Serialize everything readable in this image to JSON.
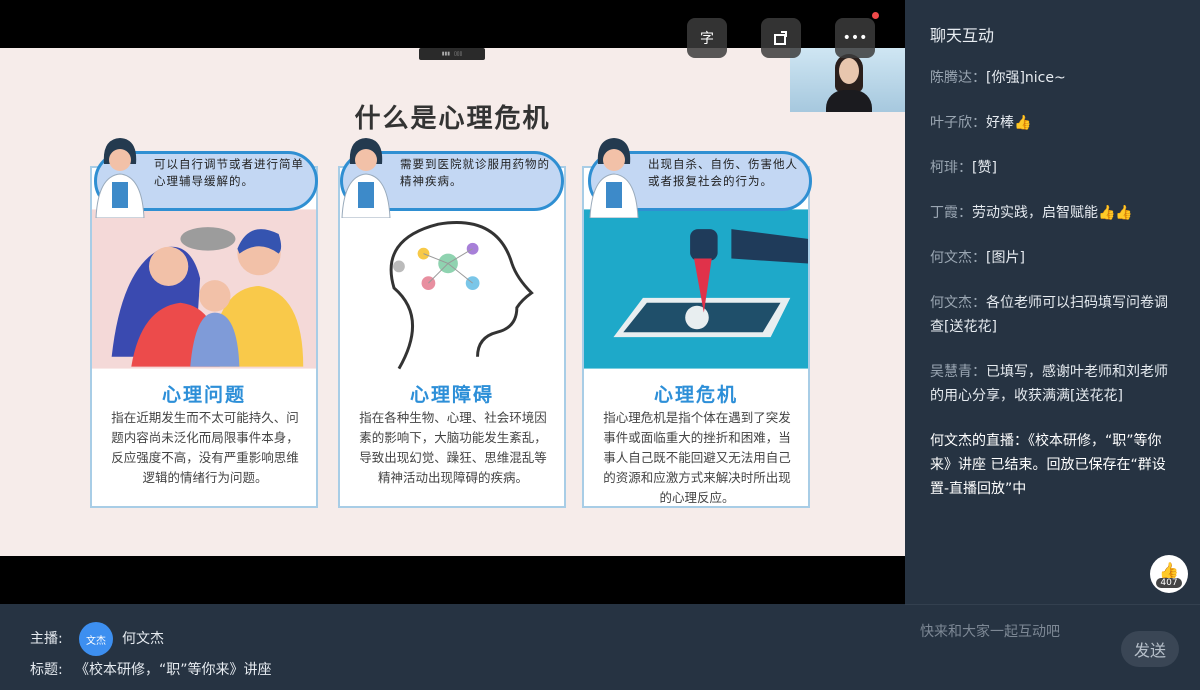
{
  "slide": {
    "title": "什么是心理危机",
    "cards": [
      {
        "bubble": "可以自行调节或者进行简单心理辅导缓解的。",
        "name": "心理问题",
        "desc": "指在近期发生而不太可能持久、问题内容尚未泛化而局限事件本身，反应强度不高，没有严重影响思维逻辑的情绪行为问题。"
      },
      {
        "bubble": "需要到医院就诊服用药物的精神疾病。",
        "name": "心理障碍",
        "desc": "指在各种生物、心理、社会环境因素的影响下，大脑功能发生紊乱，导致出现幻觉、躁狂、思维混乱等精神活动出现障碍的疾病。"
      },
      {
        "bubble": "出现自杀、自伤、伤害他人或者报复社会的行为。",
        "name": "心理危机",
        "desc": "指心理危机是指个体在遇到了突发事件或面临重大的挫折和困难，当事人自己既不能回避又无法用自己的资源和应激方式来解决时所出现的心理反应。"
      }
    ]
  },
  "controls": {
    "subtitle_icon": "字",
    "rotate_icon": "rotate-icon",
    "more_icon": "•••"
  },
  "chat": {
    "title": "聊天互动",
    "messages": [
      {
        "who": "陈腾达：",
        "text": "[你强]nice~"
      },
      {
        "who": "叶子欣：",
        "text": "好棒👍"
      },
      {
        "who": "柯琲：",
        "text": "[赞]"
      },
      {
        "who": "丁霞：",
        "text": "劳动实践，启智赋能👍👍"
      },
      {
        "who": "何文杰：",
        "text": "[图片]"
      },
      {
        "who": "何文杰：",
        "text": "各位老师可以扫码填写问卷调查[送花花]"
      },
      {
        "who": "吴慧青：",
        "text": "已填写，感谢叶老师和刘老师的用心分享，收获满满[送花花]"
      }
    ],
    "system": "何文杰的直播：《校本研修，“职”等你来》讲座 已结束。回放已保存在“群设置-直播回放”中",
    "likes": "407",
    "input_placeholder": "快来和大家一起互动吧",
    "send_label": "发送"
  },
  "footer": {
    "host_label": "主播:",
    "host_avatar": "文杰",
    "host_name": "何文杰",
    "topic_label": "标题:",
    "topic": "《校本研修，“职”等你来》讲座"
  }
}
